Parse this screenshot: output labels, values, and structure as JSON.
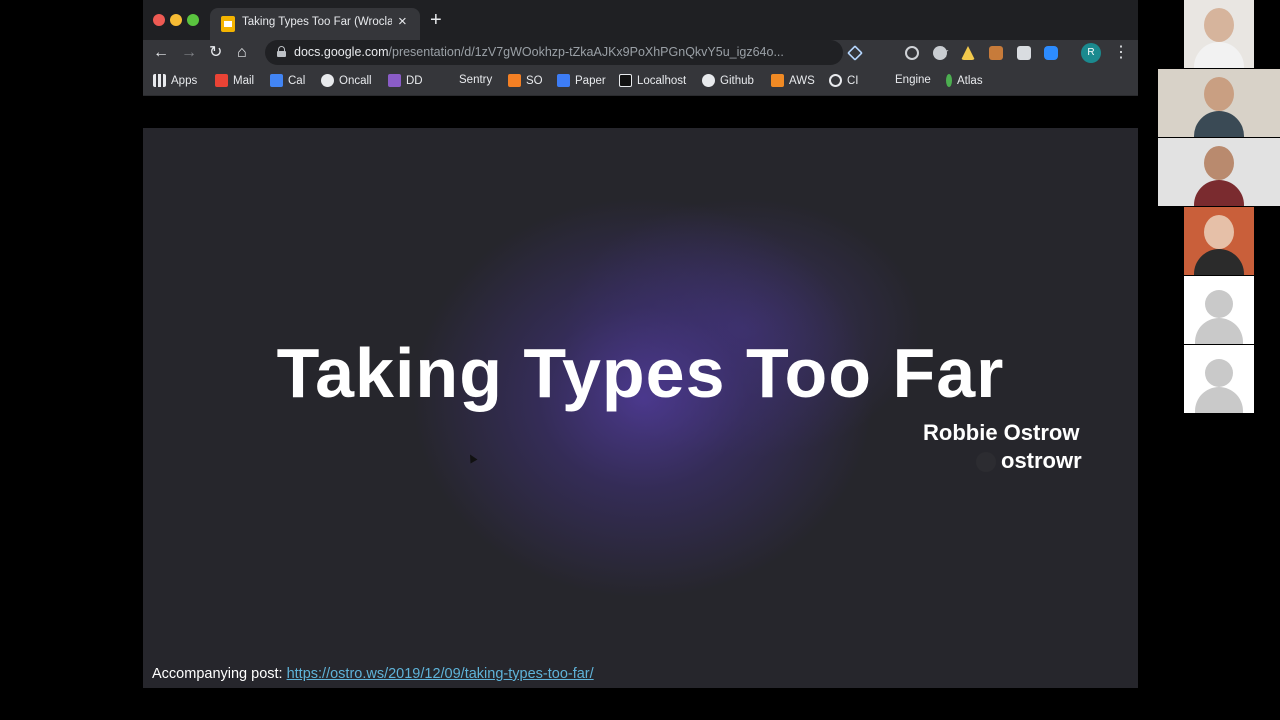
{
  "browser": {
    "tab_title": "Taking Types Too Far (Wroclaw",
    "tab_close": "×",
    "new_tab": "+",
    "url_host": "docs.google.com",
    "url_path": "/presentation/d/1zV7gWOokhzp-tZkaAJKx9PoXhPGnQkvY5u_igz64o...",
    "profile_initial": "R",
    "nav": {
      "back": "←",
      "forward": "→",
      "reload": "↻",
      "home": "⌂",
      "star": "☆",
      "menu": "⋮"
    }
  },
  "bookmarks": [
    {
      "label": "Apps",
      "icon": "apps-grid-icon",
      "color": "#e8eaed"
    },
    {
      "label": "Mail",
      "icon": "gmail-icon",
      "color": "#ea4335"
    },
    {
      "label": "Cal",
      "icon": "calendar-icon",
      "color": "#4285f4"
    },
    {
      "label": "Oncall",
      "icon": "github-icon",
      "color": "#e8eaed"
    },
    {
      "label": "DD",
      "icon": "datadog-icon",
      "color": "#8a5cc7"
    },
    {
      "label": "Sentry",
      "icon": "",
      "color": ""
    },
    {
      "label": "SO",
      "icon": "stackoverflow-icon",
      "color": "#f48024"
    },
    {
      "label": "Paper",
      "icon": "dropbox-paper-icon",
      "color": "#3d7df6"
    },
    {
      "label": "Localhost",
      "icon": "v-icon",
      "color": "#111111"
    },
    {
      "label": "Github",
      "icon": "github-icon",
      "color": "#e8eaed"
    },
    {
      "label": "AWS",
      "icon": "aws-icon",
      "color": "#f08a24"
    },
    {
      "label": "CI",
      "icon": "ci-icon",
      "color": "#e8eaed"
    },
    {
      "label": "Engine",
      "icon": "",
      "color": ""
    },
    {
      "label": "Atlas",
      "icon": "mongodb-leaf-icon",
      "color": "#4caf50"
    }
  ],
  "slide": {
    "title": "Taking Types Too Far",
    "author": "Robbie Ostrow",
    "handle": "ostrowr",
    "post_label": "Accompanying post:",
    "post_url": "https://ostro.ws/2019/12/09/taking-types-too-far/"
  },
  "colors": {
    "accent_purple": "#563eaa",
    "link": "#5fb3d9"
  }
}
